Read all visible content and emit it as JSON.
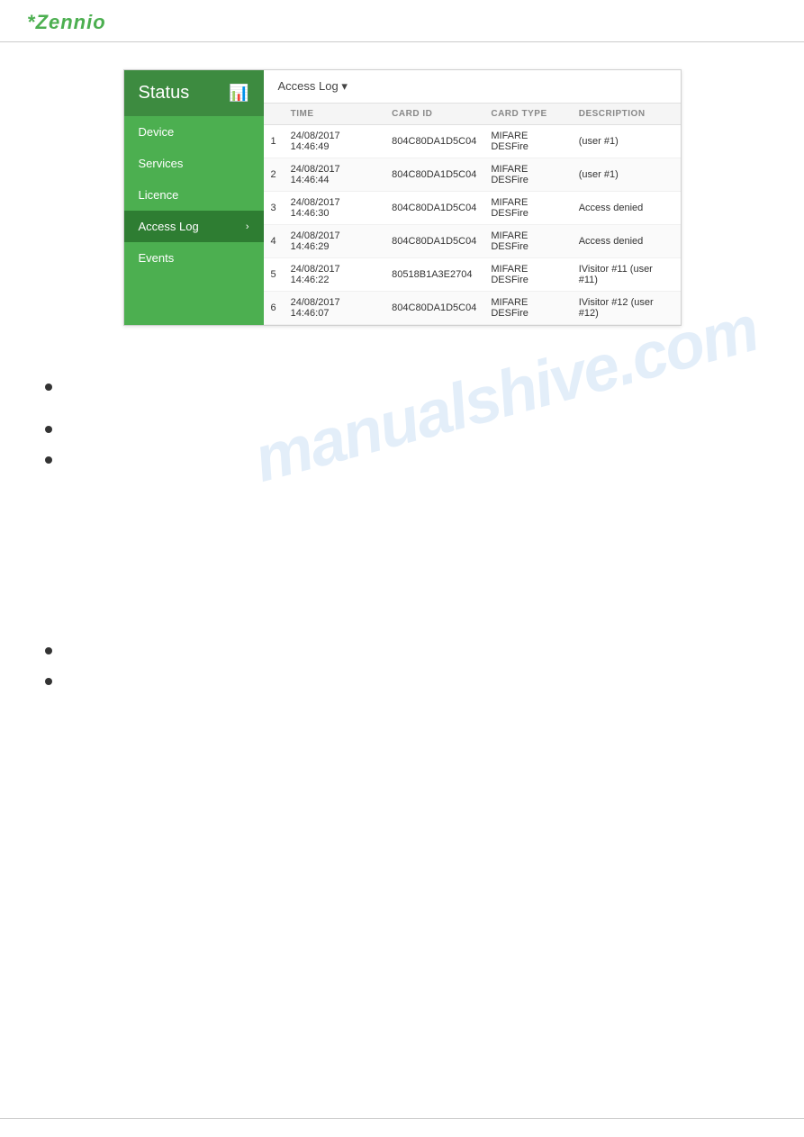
{
  "header": {
    "logo_prefix": "*",
    "logo_name": "Zennio"
  },
  "sidebar": {
    "title": "Status",
    "icon": "📊",
    "items": [
      {
        "id": "device",
        "label": "Device",
        "active": false
      },
      {
        "id": "services",
        "label": "Services",
        "active": false
      },
      {
        "id": "licence",
        "label": "Licence",
        "active": false
      },
      {
        "id": "access-log",
        "label": "Access Log",
        "active": true
      },
      {
        "id": "events",
        "label": "Events",
        "active": false
      }
    ]
  },
  "content": {
    "title": "Access Log",
    "dropdown_symbol": "▾",
    "table": {
      "columns": [
        "",
        "TIME",
        "CARD ID",
        "CARD TYPE",
        "DESCRIPTION"
      ],
      "rows": [
        {
          "num": "1",
          "time": "24/08/2017 14:46:49",
          "card_id": "804C80DA1D5C04",
          "card_type": "MIFARE DESFire",
          "description": "(user #1)"
        },
        {
          "num": "2",
          "time": "24/08/2017 14:46:44",
          "card_id": "804C80DA1D5C04",
          "card_type": "MIFARE DESFire",
          "description": "(user #1)"
        },
        {
          "num": "3",
          "time": "24/08/2017 14:46:30",
          "card_id": "804C80DA1D5C04",
          "card_type": "MIFARE DESFire",
          "description": "Access denied"
        },
        {
          "num": "4",
          "time": "24/08/2017 14:46:29",
          "card_id": "804C80DA1D5C04",
          "card_type": "MIFARE DESFire",
          "description": "Access denied"
        },
        {
          "num": "5",
          "time": "24/08/2017 14:46:22",
          "card_id": "80518B1A3E2704",
          "card_type": "MIFARE DESFire",
          "description": "IVisitor #11 (user #11)"
        },
        {
          "num": "6",
          "time": "24/08/2017 14:46:07",
          "card_id": "804C80DA1D5C04",
          "card_type": "MIFARE DESFire",
          "description": "IVisitor #12 (user #12)"
        }
      ]
    }
  },
  "watermark": {
    "text": "manualshive.com"
  },
  "bullets": [
    {
      "id": "b1",
      "text": ""
    },
    {
      "id": "b2",
      "text": ""
    },
    {
      "id": "b3",
      "text": ""
    },
    {
      "id": "b4",
      "text": ""
    },
    {
      "id": "b5",
      "text": ""
    }
  ]
}
